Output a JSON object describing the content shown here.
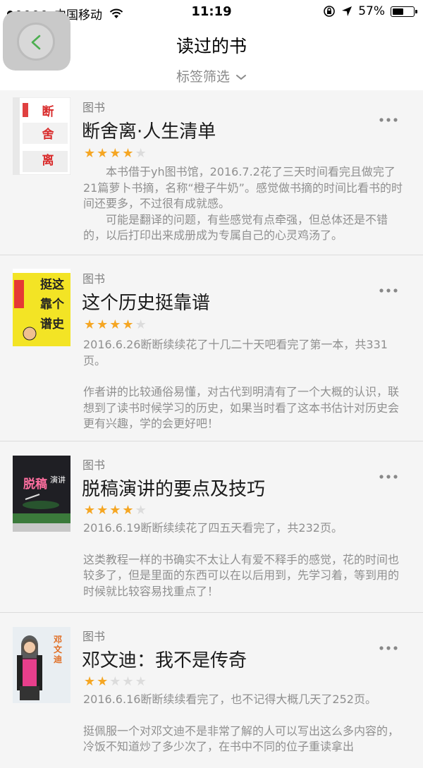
{
  "status": {
    "carrier": "中国移动",
    "time": "11:19",
    "battery": "57%",
    "battery_fraction": 0.57
  },
  "header": {
    "title": "读过的书",
    "filter_label": "标签筛选"
  },
  "books": [
    {
      "type": "图书",
      "title": "断舍离·人生清单",
      "rating": 4,
      "paragraphs": [
        "本书借于yh图书馆，2016.7.2花了三天时间看完且做完了21篇萝卜书摘，名称“橙子牛奶”。感觉做书摘的时间比看书的时间还要多，不过很有成就感。",
        "可能是翻译的问题，有些感觉有点牵强，但总体还是不错的，以后打印出来成册成为专属自己的心灵鸡汤了。"
      ],
      "cover_text": "断舍离"
    },
    {
      "type": "图书",
      "title": "这个历史挺靠谱",
      "rating": 4,
      "paragraphs": [
        "2016.6.26断断续续花了十几二十天吧看完了第一本，共331页。",
        "",
        "作者讲的比较通俗易懂，对古代到明清有了一个大概的认识，联想到了读书时候学习的历史，如果当时看了这本书估计对历史会更有兴趣，学的会更好吧！"
      ],
      "cover_text": "这个历史挺靠谱"
    },
    {
      "type": "图书",
      "title": "脱稿演讲的要点及技巧",
      "rating": 4,
      "paragraphs": [
        "2016.6.19断断续续花了四五天看完了，共232页。",
        "",
        "这类教程一样的书确实不太让人有爱不释手的感觉，花的时间也较多了，但是里面的东西可以在以后用到，先学习着，等到用的时候就比较容易找重点了！"
      ],
      "cover_text": "脱稿演讲"
    },
    {
      "type": "图书",
      "title": "邓文迪：我不是传奇",
      "rating": 2,
      "paragraphs": [
        "2016.6.16断断续续看完了，也不记得大概几天了252页。",
        "",
        "挺佩服一个对邓文迪不是非常了解的人可以写出这么多内容的，冷饭不知道炒了多少次了，在书中不同的位子重读拿出"
      ],
      "cover_text": "邓文迪"
    }
  ],
  "colors": {
    "star_on": "#f5a623",
    "star_off": "#dcdcdc",
    "back_chevron": "#4caf50"
  }
}
